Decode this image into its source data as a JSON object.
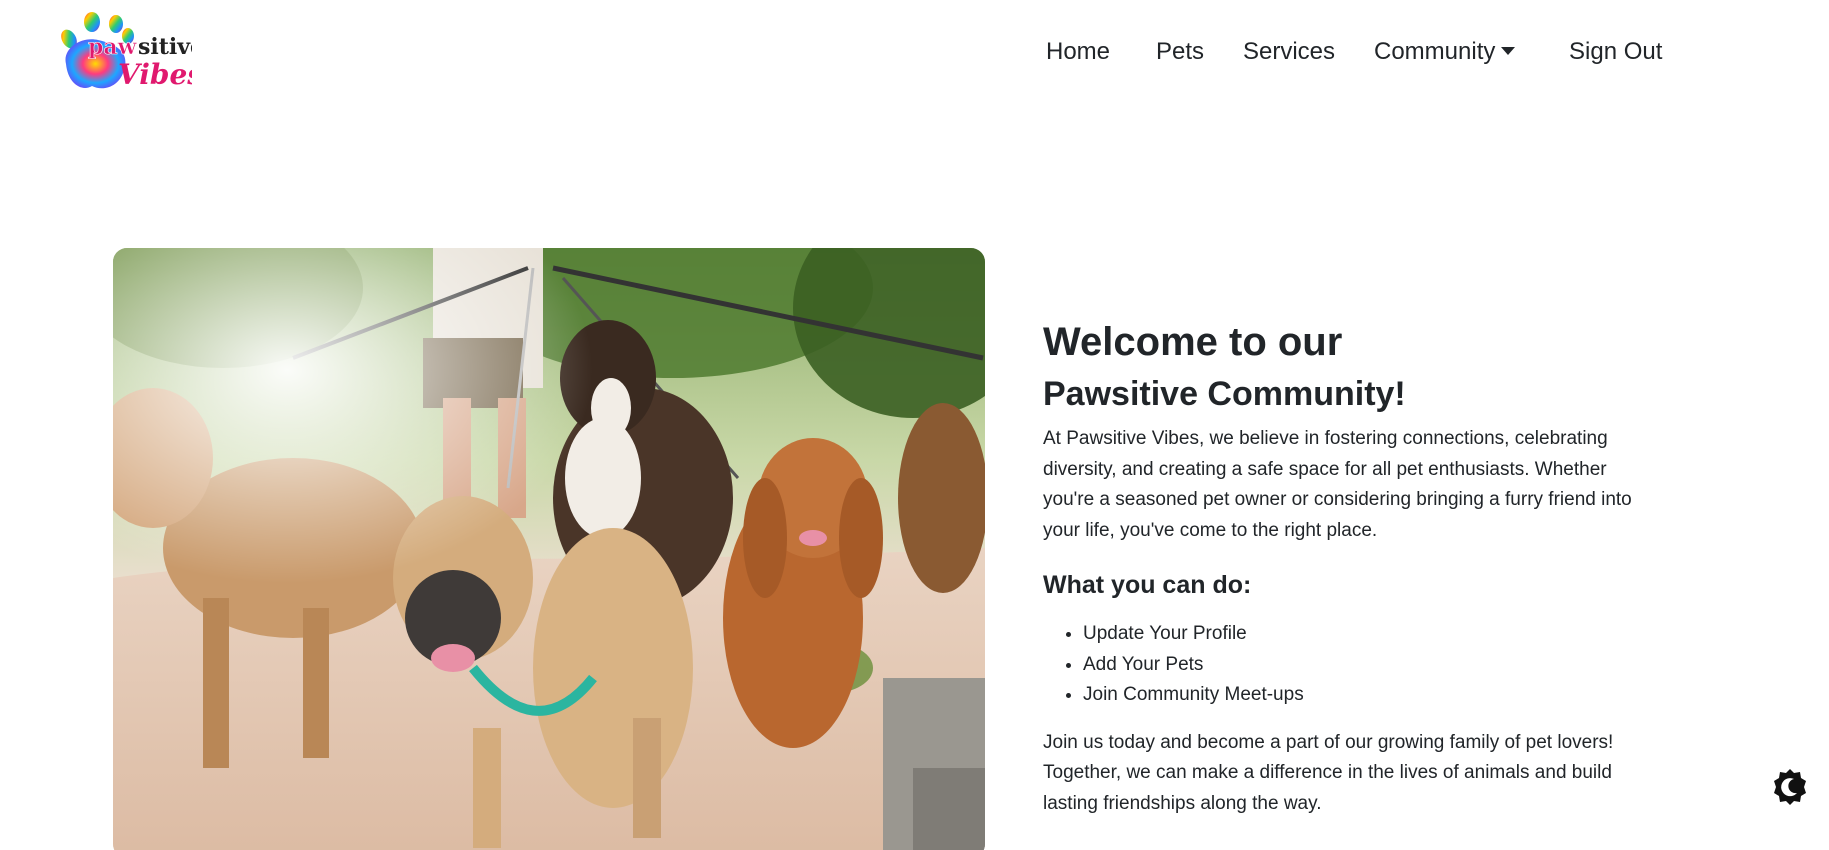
{
  "brand": {
    "logo_line1": "pawsitive",
    "logo_line2": "Vibes",
    "logo_icon": "tie-dye-paw-logo"
  },
  "nav": {
    "items": [
      {
        "label": "Home"
      },
      {
        "label": "Pets"
      },
      {
        "label": "Services"
      },
      {
        "label": "Community",
        "has_dropdown": true
      },
      {
        "label": "Sign Out"
      }
    ]
  },
  "hero": {
    "image": "photo-dogs-on-leashes-walk",
    "heading_line1": "Welcome to our",
    "heading_line2": "Pawsitive Community!",
    "intro": "At Pawsitive Vibes, we believe in fostering connections, celebrating diversity, and creating a safe space for all pet enthusiasts. Whether you're a seasoned pet owner or considering bringing a furry friend into your life, you've come to the right place.",
    "what_heading": "What you can do:",
    "actions": [
      "Update Your Profile",
      "Add Your Pets",
      "Join Community Meet-ups"
    ],
    "closing": "Join us today and become a part of our growing family of pet lovers! Together, we can make a difference in the lives of animals and build lasting friendships along the way."
  },
  "theme_toggle": {
    "icon": "moon-icon"
  },
  "colors": {
    "text": "#212529",
    "logo_pink": "#e0196e",
    "background": "#ffffff"
  }
}
